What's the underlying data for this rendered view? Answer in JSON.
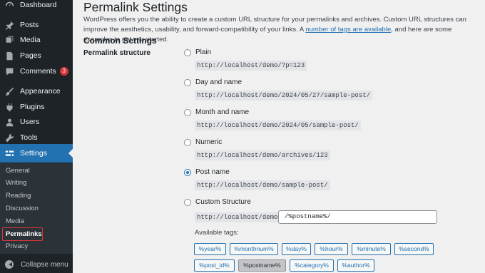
{
  "sidebar": {
    "items": [
      {
        "label": "Dashboard",
        "icon": "dashboard-icon"
      },
      {
        "label": "Posts",
        "icon": "pin-icon"
      },
      {
        "label": "Media",
        "icon": "media-icon"
      },
      {
        "label": "Pages",
        "icon": "page-icon"
      },
      {
        "label": "Comments",
        "icon": "comment-icon",
        "badge": "3"
      },
      {
        "label": "Appearance",
        "icon": "brush-icon"
      },
      {
        "label": "Plugins",
        "icon": "plug-icon"
      },
      {
        "label": "Users",
        "icon": "user-icon"
      },
      {
        "label": "Tools",
        "icon": "wrench-icon"
      },
      {
        "label": "Settings",
        "icon": "settings-icon"
      }
    ],
    "submenu": [
      "General",
      "Writing",
      "Reading",
      "Discussion",
      "Media",
      "Permalinks",
      "Privacy"
    ],
    "collapse_label": "Collapse menu"
  },
  "page": {
    "title": "Permalink Settings",
    "intro_before": "WordPress offers you the ability to create a custom URL structure for your permalinks and archives. Custom URL structures can improve the aesthetics, usability, and forward-compatibility of your links. A ",
    "intro_link": "number of tags are available",
    "intro_after": ", and here are some examples to get you started.",
    "section_title": "Common Settings",
    "row_label": "Permalink structure"
  },
  "options": [
    {
      "label": "Plain",
      "example": "http://localhost/demo/?p=123",
      "checked": false
    },
    {
      "label": "Day and name",
      "example": "http://localhost/demo/2024/05/27/sample-post/",
      "checked": false
    },
    {
      "label": "Month and name",
      "example": "http://localhost/demo/2024/05/sample-post/",
      "checked": false
    },
    {
      "label": "Numeric",
      "example": "http://localhost/demo/archives/123",
      "checked": false
    },
    {
      "label": "Post name",
      "example": "http://localhost/demo/sample-post/",
      "checked": true
    },
    {
      "label": "Custom Structure",
      "example": "http://localhost/demo",
      "checked": false
    }
  ],
  "custom_structure_value": "/%postname%/",
  "available_tags_label": "Available tags:",
  "tags_row1": [
    "%year%",
    "%monthnum%",
    "%day%",
    "%hour%",
    "%minute%",
    "%second%"
  ],
  "tags_row2": [
    "%post_id%",
    "%postname%",
    "%category%",
    "%author%"
  ],
  "colors": {
    "sidebar": "#1d2327",
    "accent": "#2271b1",
    "badge": "#d63638",
    "highlight_box": "#d63638"
  }
}
